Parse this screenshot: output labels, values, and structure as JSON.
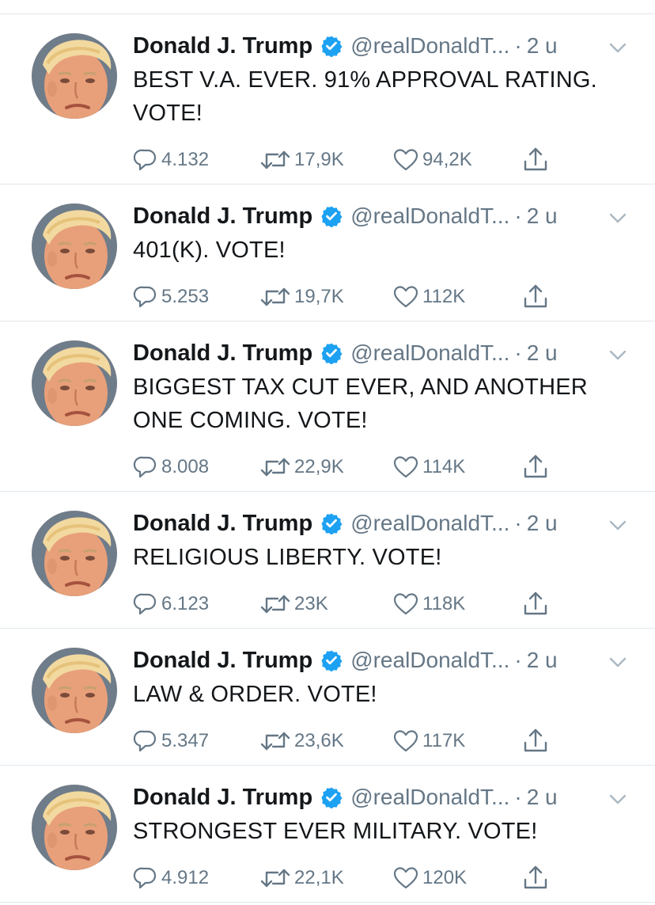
{
  "colors": {
    "text": "#14171a",
    "secondary": "#657786",
    "verified": "#1da1f2",
    "divider": "#e1e8ed"
  },
  "tweets": [
    {
      "name": "Donald J. Trump",
      "handle": "@realDonaldT...",
      "dot": "·",
      "time": "2 u",
      "text": "BEST V.A. EVER. 91% APPROVAL RATING. VOTE!",
      "replies": "4.132",
      "retweets": "17,9K",
      "likes": "94,2K"
    },
    {
      "name": "Donald J. Trump",
      "handle": "@realDonaldT...",
      "dot": "·",
      "time": "2 u",
      "text": "401(K). VOTE!",
      "replies": "5.253",
      "retweets": "19,7K",
      "likes": "112K"
    },
    {
      "name": "Donald J. Trump",
      "handle": "@realDonaldT...",
      "dot": "·",
      "time": "2 u",
      "text": "BIGGEST TAX CUT EVER, AND ANOTHER ONE COMING. VOTE!",
      "replies": "8.008",
      "retweets": "22,9K",
      "likes": "114K"
    },
    {
      "name": "Donald J. Trump",
      "handle": "@realDonaldT...",
      "dot": "·",
      "time": "2 u",
      "text": "RELIGIOUS LIBERTY. VOTE!",
      "replies": "6.123",
      "retweets": "23K",
      "likes": "118K"
    },
    {
      "name": "Donald J. Trump",
      "handle": "@realDonaldT...",
      "dot": "·",
      "time": "2 u",
      "text": "LAW & ORDER. VOTE!",
      "replies": "5.347",
      "retweets": "23,6K",
      "likes": "117K"
    },
    {
      "name": "Donald J. Trump",
      "handle": "@realDonaldT...",
      "dot": "·",
      "time": "2 u",
      "text": "STRONGEST EVER MILITARY. VOTE!",
      "replies": "4.912",
      "retweets": "22,1K",
      "likes": "120K"
    }
  ]
}
